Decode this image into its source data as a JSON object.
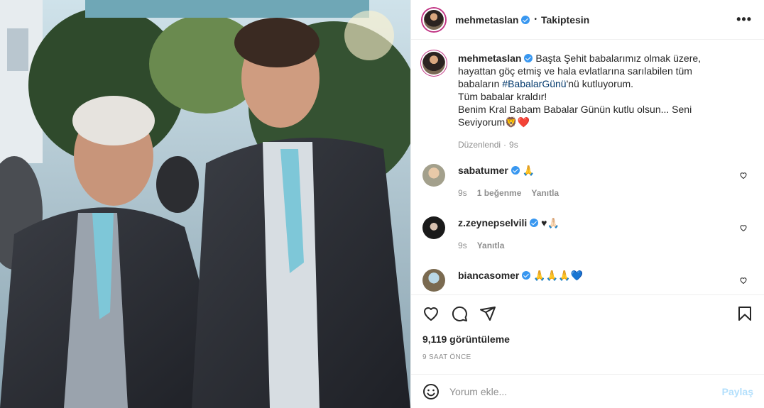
{
  "header": {
    "username": "mehmetaslan",
    "follow_status": "Takiptesin",
    "more_label": "•••"
  },
  "caption": {
    "username": "mehmetaslan",
    "text_part1": " Başta Şehit babalarımız olmak üzere, hayattan göç etmiş ve hala evlatlarına sarılabilen tüm babaların ",
    "hashtag": "#BabalarGünü",
    "text_part2": "'nü kutluyorum.",
    "line2": "Tüm babalar kraldır!",
    "line3": "Benim Kral Babam Babalar Günün kutlu olsun... Seni Seviyorum🦁❤️",
    "edited": "Düzenlendi",
    "time": "9s"
  },
  "comments": [
    {
      "username": "sabatumer",
      "text": "🙏",
      "time": "9s",
      "likes": "1 beğenme",
      "reply": "Yanıtla"
    },
    {
      "username": "z.zeynepselvili",
      "text": "♥🙏🏻",
      "time": "9s",
      "reply": "Yanıtla"
    },
    {
      "username": "biancasomer",
      "text": "🙏🙏🙏💙"
    }
  ],
  "actions": {
    "views": "9,119 görüntüleme",
    "time_ago": "9 SAAT ÖNCE"
  },
  "add_comment": {
    "placeholder": "Yorum ekle...",
    "post_label": "Paylaş"
  },
  "colors": {
    "accent": "#3897f0",
    "hashtag": "#00376b",
    "muted": "#8e8e8e",
    "post_disabled": "#b2dffc"
  }
}
